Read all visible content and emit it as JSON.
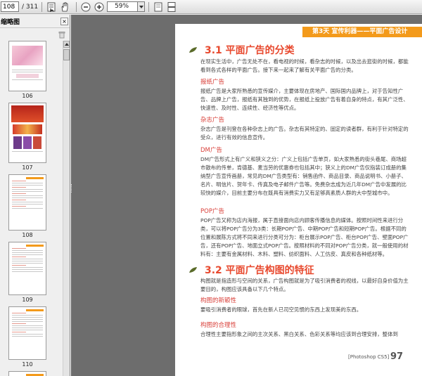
{
  "toolbar": {
    "current_page": "108",
    "total_pages": "/ 311",
    "zoom": "59%"
  },
  "sidebar": {
    "title": "缩略图",
    "close_label": "×",
    "thumbnails": [
      {
        "num": "106"
      },
      {
        "num": "107"
      },
      {
        "num": "108"
      },
      {
        "num": "109"
      },
      {
        "num": "110"
      }
    ]
  },
  "page": {
    "banner": "第3天  宣传利器——平面广告设计",
    "section1_title": "3.1  平面广告的分类",
    "section1_intro": "在现实生活中，广告无处不在，看电视的时候，看杂志的时候，以及出去逛街的时候，都能看到各式各样的平面广告。接下来一起来了解有关平面广告的分类。",
    "sub1": "报纸广告",
    "para1": "报纸广告是大家所熟悉的宣传媒介，主要体现在房地产、国际国内品牌上，对于告知性广告、品牌上广告，报纸有其独到的优势，在报纸上投放广告有着自身的特点，有其广泛性、快速性、及时性、连续性、经济性等优点。",
    "sub2": "杂志广告",
    "para2": "杂志广告是刊登在各种杂志上的广告。杂志有其特定的、固定的读者群，有利于针对特定的受众，进行有效的信息宣传。",
    "sub3": "DM广告",
    "para3": "DM广告形式上有广义和狭义之分：广义上包括广告单页，如大家熟悉的街头巷尾、商场超市散布的传单，肯德基、麦当劳的优惠券也包括其中；狭义上的DM广告仅指装订成册的集纳型广告宣传画册，常见的DM广告类型有：销售函件、商品目录、商品说明书、小册子、名片、明信片、贺年卡、传真及电子邮件广告等。免费杂志成为近几年DM广告中发展的比较快的媒介，目前主要分布在既具有消费实力又有足够高素质人群的大中型城市中。",
    "sub4": "POP广告",
    "para4": "POP广告又称为店内海报，属于直接面向店内顾客传播信息的媒体。按照时间性来进行分类，可以将POP广告分为3类：长期POP广告、中期POP广告和短期POP广告。根据不同的位置和展陈方式将不同来进行分类可分为：柜台展示POP广告、柜台POP广告、壁面POP广告，还有POP广告、地面立式POP广告。按照材料的不同对POP广告分类，就一般使用的材料有：主要有金属材料、木料、塑料、纺织面料、人工仿皮、真皮和各种纸材等。",
    "section2_title": "3.2  平面广告构图的特征",
    "section2_intro": "构图就是指造形与空间的关系，广告构图就是为了吸引消费者的视线，以最好自身价值为主要目的，构图应该具备以下几个特点。",
    "sub5": "构图的新颖性",
    "para5": "要吸引消费者的眼球，首先在新人已司空见惯的东西上发现美的东西。",
    "sub6": "构图的合理性",
    "para6": "合理性主要指形象之间的主次关系、黑白关系、色彩关系等均应该到合理安排，整体到",
    "footer_label": "[Photoshop CS5]",
    "page_number": "97"
  }
}
